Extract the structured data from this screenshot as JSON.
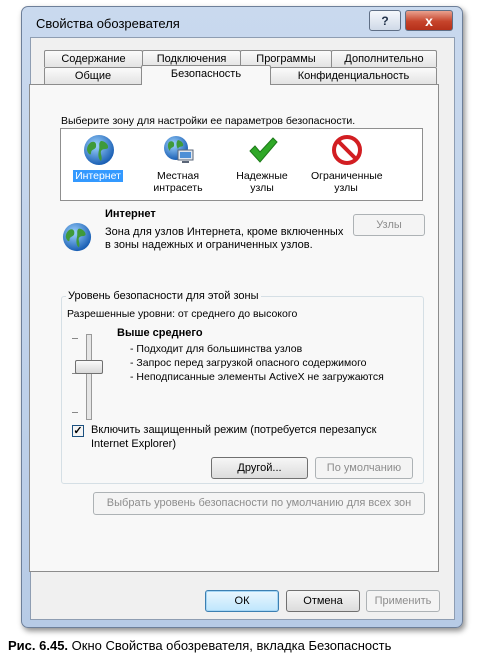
{
  "window": {
    "title": "Свойства обозревателя",
    "help_label": "?",
    "close_label": "x"
  },
  "tabs": {
    "row_back": [
      "Содержание",
      "Подключения",
      "Программы",
      "Дополнительно"
    ],
    "row_front": [
      "Общие",
      "Безопасность",
      "Конфиденциальность"
    ],
    "active": "Безопасность"
  },
  "zones": {
    "prompt": "Выберите зону для настройки ее параметров безопасности.",
    "items": [
      {
        "name": "Интернет",
        "icon": "globe-icon",
        "selected": true
      },
      {
        "name": "Местная интрасеть",
        "icon": "intranet-icon",
        "selected": false
      },
      {
        "name": "Надежные узлы",
        "icon": "checkmark-icon",
        "selected": false
      },
      {
        "name": "Ограниченные узлы",
        "icon": "prohibited-icon",
        "selected": false
      }
    ],
    "selected_title": "Интернет",
    "selected_desc_line1": "Зона для узлов Интернета, кроме включенных",
    "selected_desc_line2": "в зоны надежных и ограниченных узлов.",
    "sites_button": "Узлы"
  },
  "security_level": {
    "group_label": "Уровень безопасности для этой зоны",
    "allowed_levels": "Разрешенные уровни: от среднего до высокого",
    "level_title": "Выше среднего",
    "bullets": [
      "- Подходит для большинства узлов",
      "- Запрос перед загрузкой опасного содержимого",
      "- Неподписанные элементы ActiveX не загружаются"
    ],
    "slider_level": "Выше среднего",
    "protected_mode_checked": true,
    "protected_mode_line1": "Включить защищенный режим (потребуется перезапуск",
    "protected_mode_line2": "Internet Explorer)",
    "custom_button": "Другой...",
    "default_button": "По умолчанию"
  },
  "reset_all_button": "Выбрать уровень безопасности по умолчанию для всех зон",
  "footer": {
    "ok": "ОК",
    "cancel": "Отмена",
    "apply": "Применить"
  },
  "caption": {
    "number": "Рис. 6.45.",
    "text": "Окно Свойства обозревателя, вкладка Безопасность"
  },
  "colors": {
    "selection": "#3399ff",
    "close_button": "#c6442b",
    "check_green": "#2fa827",
    "prohibited_red": "#d21e22"
  }
}
